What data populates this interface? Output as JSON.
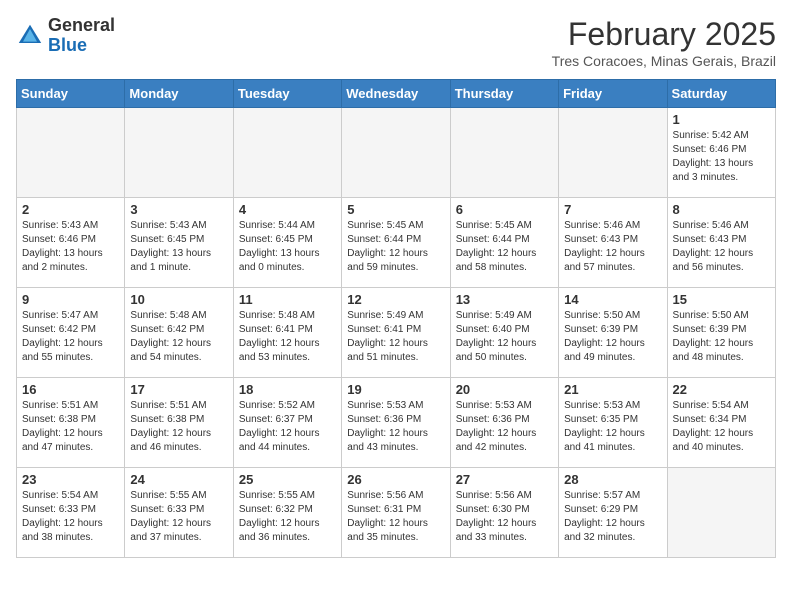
{
  "header": {
    "logo_general": "General",
    "logo_blue": "Blue",
    "month_title": "February 2025",
    "subtitle": "Tres Coracoes, Minas Gerais, Brazil"
  },
  "days_of_week": [
    "Sunday",
    "Monday",
    "Tuesday",
    "Wednesday",
    "Thursday",
    "Friday",
    "Saturday"
  ],
  "weeks": [
    [
      {
        "day": "",
        "info": ""
      },
      {
        "day": "",
        "info": ""
      },
      {
        "day": "",
        "info": ""
      },
      {
        "day": "",
        "info": ""
      },
      {
        "day": "",
        "info": ""
      },
      {
        "day": "",
        "info": ""
      },
      {
        "day": "1",
        "info": "Sunrise: 5:42 AM\nSunset: 6:46 PM\nDaylight: 13 hours\nand 3 minutes."
      }
    ],
    [
      {
        "day": "2",
        "info": "Sunrise: 5:43 AM\nSunset: 6:46 PM\nDaylight: 13 hours\nand 2 minutes."
      },
      {
        "day": "3",
        "info": "Sunrise: 5:43 AM\nSunset: 6:45 PM\nDaylight: 13 hours\nand 1 minute."
      },
      {
        "day": "4",
        "info": "Sunrise: 5:44 AM\nSunset: 6:45 PM\nDaylight: 13 hours\nand 0 minutes."
      },
      {
        "day": "5",
        "info": "Sunrise: 5:45 AM\nSunset: 6:44 PM\nDaylight: 12 hours\nand 59 minutes."
      },
      {
        "day": "6",
        "info": "Sunrise: 5:45 AM\nSunset: 6:44 PM\nDaylight: 12 hours\nand 58 minutes."
      },
      {
        "day": "7",
        "info": "Sunrise: 5:46 AM\nSunset: 6:43 PM\nDaylight: 12 hours\nand 57 minutes."
      },
      {
        "day": "8",
        "info": "Sunrise: 5:46 AM\nSunset: 6:43 PM\nDaylight: 12 hours\nand 56 minutes."
      }
    ],
    [
      {
        "day": "9",
        "info": "Sunrise: 5:47 AM\nSunset: 6:42 PM\nDaylight: 12 hours\nand 55 minutes."
      },
      {
        "day": "10",
        "info": "Sunrise: 5:48 AM\nSunset: 6:42 PM\nDaylight: 12 hours\nand 54 minutes."
      },
      {
        "day": "11",
        "info": "Sunrise: 5:48 AM\nSunset: 6:41 PM\nDaylight: 12 hours\nand 53 minutes."
      },
      {
        "day": "12",
        "info": "Sunrise: 5:49 AM\nSunset: 6:41 PM\nDaylight: 12 hours\nand 51 minutes."
      },
      {
        "day": "13",
        "info": "Sunrise: 5:49 AM\nSunset: 6:40 PM\nDaylight: 12 hours\nand 50 minutes."
      },
      {
        "day": "14",
        "info": "Sunrise: 5:50 AM\nSunset: 6:39 PM\nDaylight: 12 hours\nand 49 minutes."
      },
      {
        "day": "15",
        "info": "Sunrise: 5:50 AM\nSunset: 6:39 PM\nDaylight: 12 hours\nand 48 minutes."
      }
    ],
    [
      {
        "day": "16",
        "info": "Sunrise: 5:51 AM\nSunset: 6:38 PM\nDaylight: 12 hours\nand 47 minutes."
      },
      {
        "day": "17",
        "info": "Sunrise: 5:51 AM\nSunset: 6:38 PM\nDaylight: 12 hours\nand 46 minutes."
      },
      {
        "day": "18",
        "info": "Sunrise: 5:52 AM\nSunset: 6:37 PM\nDaylight: 12 hours\nand 44 minutes."
      },
      {
        "day": "19",
        "info": "Sunrise: 5:53 AM\nSunset: 6:36 PM\nDaylight: 12 hours\nand 43 minutes."
      },
      {
        "day": "20",
        "info": "Sunrise: 5:53 AM\nSunset: 6:36 PM\nDaylight: 12 hours\nand 42 minutes."
      },
      {
        "day": "21",
        "info": "Sunrise: 5:53 AM\nSunset: 6:35 PM\nDaylight: 12 hours\nand 41 minutes."
      },
      {
        "day": "22",
        "info": "Sunrise: 5:54 AM\nSunset: 6:34 PM\nDaylight: 12 hours\nand 40 minutes."
      }
    ],
    [
      {
        "day": "23",
        "info": "Sunrise: 5:54 AM\nSunset: 6:33 PM\nDaylight: 12 hours\nand 38 minutes."
      },
      {
        "day": "24",
        "info": "Sunrise: 5:55 AM\nSunset: 6:33 PM\nDaylight: 12 hours\nand 37 minutes."
      },
      {
        "day": "25",
        "info": "Sunrise: 5:55 AM\nSunset: 6:32 PM\nDaylight: 12 hours\nand 36 minutes."
      },
      {
        "day": "26",
        "info": "Sunrise: 5:56 AM\nSunset: 6:31 PM\nDaylight: 12 hours\nand 35 minutes."
      },
      {
        "day": "27",
        "info": "Sunrise: 5:56 AM\nSunset: 6:30 PM\nDaylight: 12 hours\nand 33 minutes."
      },
      {
        "day": "28",
        "info": "Sunrise: 5:57 AM\nSunset: 6:29 PM\nDaylight: 12 hours\nand 32 minutes."
      },
      {
        "day": "",
        "info": ""
      }
    ]
  ]
}
